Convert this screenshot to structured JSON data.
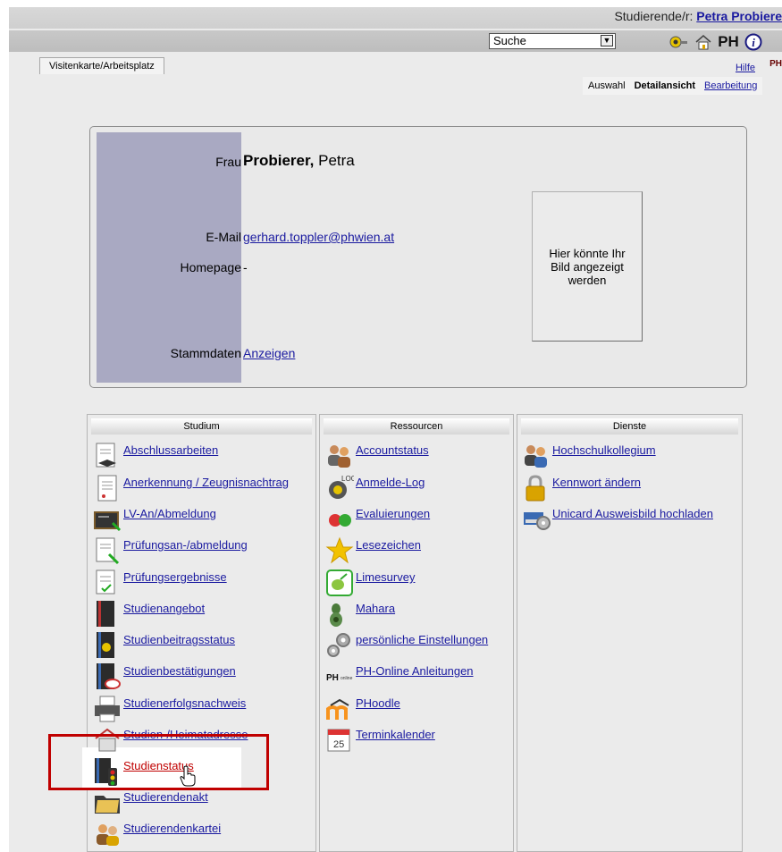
{
  "header": {
    "user_prefix": "Studierende/r:",
    "user_name": "Petra Probiere",
    "search_value": "Suche",
    "tab_label": "Visitenkarte/Arbeitsplatz",
    "help_label": "Hilfe",
    "logo_text": "PH",
    "icons": [
      "key-icon",
      "home-icon",
      "ph-logo-icon",
      "info-icon"
    ]
  },
  "views": {
    "auswahl": "Auswahl",
    "detail": "Detailansicht",
    "bearbeitung": "Bearbeitung"
  },
  "card": {
    "salutation": "Frau",
    "lastname": "Probierer,",
    "firstname": "Petra",
    "email_label": "E-Mail",
    "email": "gerhard.toppler@phwien.at",
    "homepage_label": "Homepage",
    "homepage": "-",
    "stamm_label": "Stammdaten",
    "stamm_link": "Anzeigen",
    "photo_text": "Hier könnte Ihr Bild angezeigt werden"
  },
  "columns": {
    "studium": {
      "title": "Studium",
      "items": [
        {
          "label": "Abschlussarbeiten",
          "icon": "thesis-icon"
        },
        {
          "label": "Anerkennung / Zeugnisnachtrag",
          "icon": "document-icon"
        },
        {
          "label": "LV-An/Abmeldung",
          "icon": "blackboard-icon"
        },
        {
          "label": "Prüfungsan-/abmeldung",
          "icon": "exam-register-icon"
        },
        {
          "label": "Prüfungsergebnisse",
          "icon": "exam-results-icon"
        },
        {
          "label": "Studienangebot",
          "icon": "book-icon"
        },
        {
          "label": "Studienbeitragsstatus",
          "icon": "book-coin-icon"
        },
        {
          "label": "Studienbestätigungen",
          "icon": "book-stamp-icon"
        },
        {
          "label": "Studienerfolgsnachweis",
          "icon": "printer-icon"
        },
        {
          "label": "Studien-/Heimatadresse",
          "icon": "house-icon"
        },
        {
          "label": "Studienstatus",
          "icon": "traffic-light-icon"
        },
        {
          "label": "Studierendenakt",
          "icon": "folder-icon"
        },
        {
          "label": "Studierendenkartei",
          "icon": "people-icon"
        }
      ]
    },
    "ressourcen": {
      "title": "Ressourcen",
      "items": [
        {
          "label": "Accountstatus",
          "icon": "users-icon"
        },
        {
          "label": "Anmelde-Log",
          "icon": "log-icon"
        },
        {
          "label": "Evaluierungen",
          "icon": "smiley-icon"
        },
        {
          "label": "Lesezeichen",
          "icon": "star-icon"
        },
        {
          "label": "Limesurvey",
          "icon": "lime-icon"
        },
        {
          "label": "Mahara",
          "icon": "mahara-icon"
        },
        {
          "label": "persönliche Einstellungen",
          "icon": "gear-icon"
        },
        {
          "label": "PH-Online Anleitungen",
          "icon": "ph-online-icon"
        },
        {
          "label": "PHoodle",
          "icon": "moodle-icon"
        },
        {
          "label": "Terminkalender",
          "icon": "calendar-icon"
        }
      ]
    },
    "dienste": {
      "title": "Dienste",
      "items": [
        {
          "label": "Hochschulkollegium",
          "icon": "group-icon"
        },
        {
          "label": "Kennwort ändern",
          "icon": "padlock-icon"
        },
        {
          "label": "Unicard Ausweisbild hochladen",
          "icon": "card-reader-icon"
        }
      ]
    }
  },
  "calendar_day": "25",
  "colors": {
    "link": "#1a1aa0",
    "highlight_red": "#c00000",
    "card_side": "#a9a9c2"
  }
}
